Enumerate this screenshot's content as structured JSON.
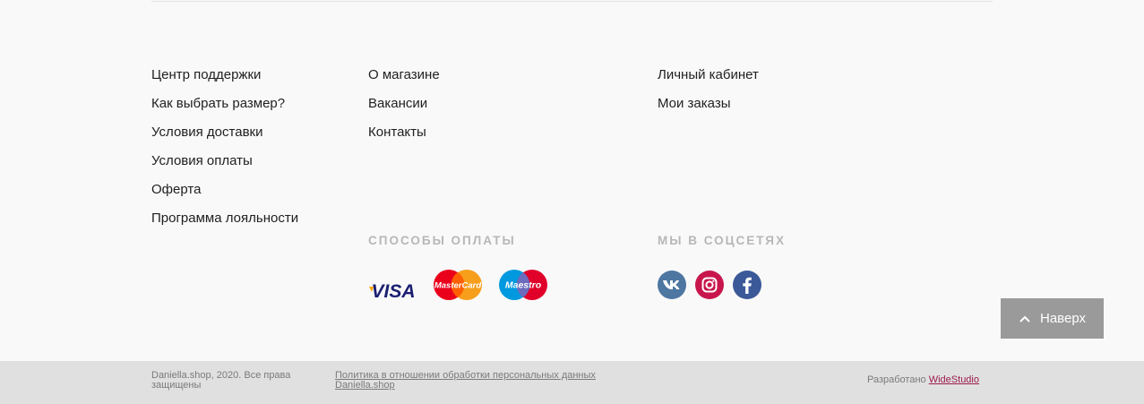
{
  "nav": {
    "col1": [
      "Центр поддержки",
      "Как выбрать размер?",
      "Условия доставки",
      "Условия оплаты",
      "Оферта",
      "Программа лояльности"
    ],
    "col2": [
      "О магазине",
      "Вакансии",
      "Контакты"
    ],
    "col3": [
      "Личный кабинет",
      "Мои заказы"
    ]
  },
  "payment": {
    "title": "СПОСОБЫ ОПЛАТЫ",
    "icons": [
      "visa-icon",
      "mastercard-icon",
      "maestro-icon"
    ],
    "visa_text": "VISA",
    "mastercard_text": "MasterCard",
    "maestro_text": "Maestro"
  },
  "social": {
    "title": "МЫ В СОЦСЕТЯХ",
    "icons": [
      "vk-icon",
      "instagram-icon",
      "facebook-icon"
    ],
    "colors": {
      "vk": "#4d76a1",
      "instagram": "#c8164d",
      "facebook": "#3b5998"
    }
  },
  "to_top": {
    "label": "Наверх"
  },
  "footer": {
    "copyright": "Daniella.shop, 2020. Все права защищены",
    "policy": "Политика в отношении обработки персональных данных Daniella.shop",
    "developed_prefix": "Разработано",
    "developer": "WideStudio",
    "developer_color": "#9b1c4a"
  }
}
